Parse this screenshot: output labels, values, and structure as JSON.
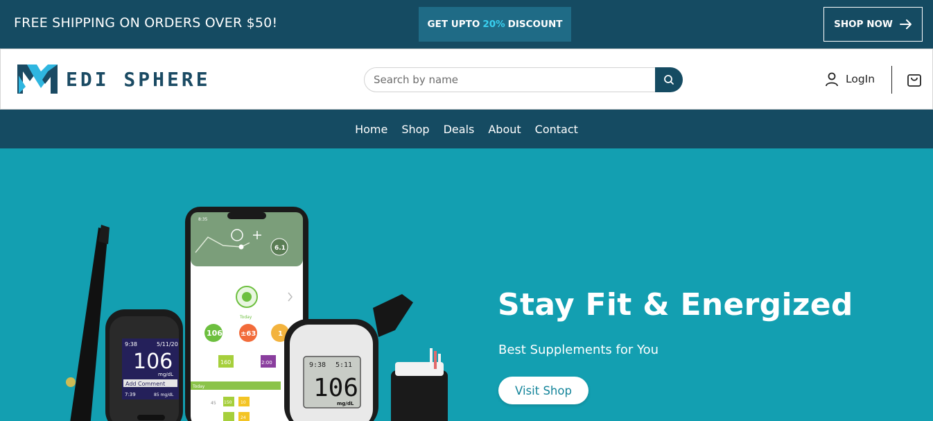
{
  "topbar": {
    "shipping_text": "FREE SHIPPING ON ORDERS OVER $50!",
    "promo_prefix": "GET UPTO",
    "promo_percent": "20%",
    "promo_suffix": "DISCOUNT",
    "shop_now_label": "SHOP NOW"
  },
  "header": {
    "brand_name": "EDI SPHERE",
    "search_placeholder": "Search by name",
    "login_label": "LogIn"
  },
  "nav": {
    "items": [
      {
        "label": "Home"
      },
      {
        "label": "Shop"
      },
      {
        "label": "Deals"
      },
      {
        "label": "About"
      },
      {
        "label": "Contact"
      }
    ]
  },
  "hero": {
    "title": "Stay Fit & Energized",
    "subtitle": "Best Supplements for You",
    "button_label": "Visit Shop",
    "meter1": {
      "time": "9:38",
      "date": "5/11/20",
      "value": "106",
      "unit": "mg/dL",
      "comment": "Add Comment",
      "footer_time": "7:39",
      "footer_value": "85 mg/dL"
    },
    "meter2": {
      "time": "9:38",
      "date": "5:11",
      "value": "106",
      "unit": "mg/dL"
    },
    "phone": {
      "status_time": "8:35",
      "top_value": "6.1",
      "today_label": "Today",
      "stat1": "106",
      "stat2": "±63",
      "stat3": "1",
      "chip1": "160",
      "chip2": "2:00",
      "chip3": "150",
      "chip4": "10",
      "chip5": "24",
      "chip6": "45",
      "band_label": "Today"
    }
  },
  "colors": {
    "primary_dark": "#154b62",
    "promo_bg": "#1f6b86",
    "promo_accent": "#39d0f0",
    "hero_bg": "#139fb1",
    "button_text": "#13849a"
  },
  "icons": {
    "shop_now": "arrow-right-icon",
    "search": "search-icon",
    "login": "user-icon",
    "cart": "shopping-bag-icon",
    "logo": "medisphere-m-logo-icon"
  }
}
